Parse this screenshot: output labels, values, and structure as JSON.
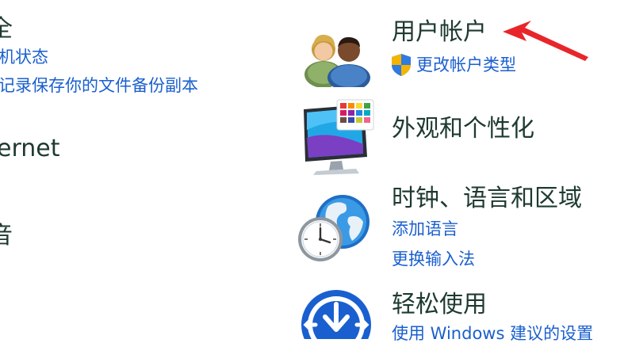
{
  "left_column": {
    "security_heading_fragment": "全",
    "link_1": "机状态",
    "link_2": "记录保存你的文件备份副本",
    "network_heading_fragment": "ernet",
    "hardware_heading_fragment": "音"
  },
  "right_column": {
    "user_accounts": {
      "title": "用户帐户",
      "link": "更改帐户类型"
    },
    "appearance": {
      "title": "外观和个性化"
    },
    "clock_region": {
      "title": "时钟、语言和区域",
      "link_1": "添加语言",
      "link_2": "更换输入法"
    },
    "ease_of_access": {
      "title": "轻松使用",
      "link": "使用 Windows 建议的设置"
    }
  },
  "colors": {
    "heading": "#1e3a2f",
    "link": "#1a5fcf",
    "arrow": "#e8262a"
  },
  "icons": [
    "users-icon",
    "shield-icon",
    "monitor-palette-icon",
    "globe-clock-icon",
    "accessibility-icon",
    "red-arrow-annotation"
  ]
}
